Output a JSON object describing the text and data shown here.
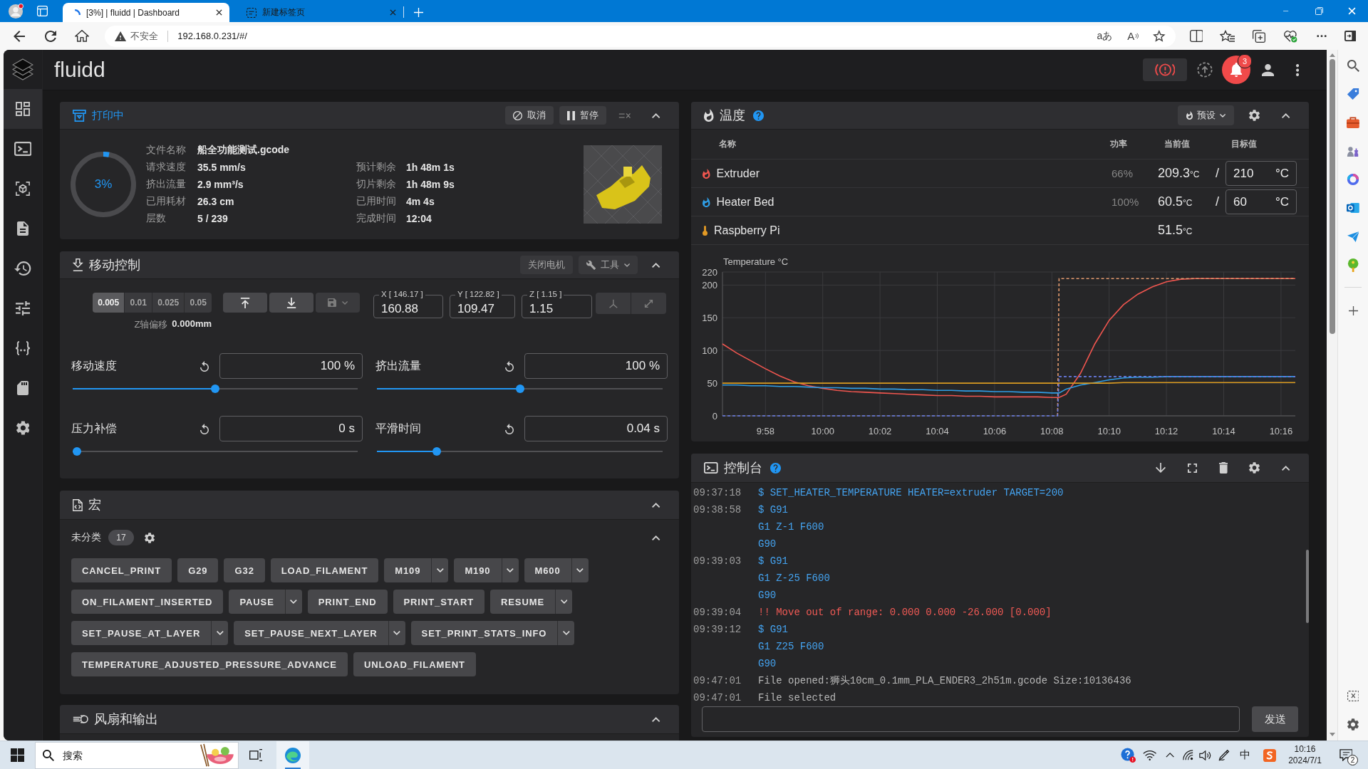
{
  "browser": {
    "tabs": [
      {
        "kind": "loading",
        "title": "[3%] | fluidd | Dashboard",
        "selected": true
      },
      {
        "kind": "newtab",
        "title": "新建标签页",
        "selected": false
      }
    ],
    "security_label": "不安全",
    "address": "192.168.0.231/#/",
    "translate_glyph": "aあ",
    "read_aloud_glyph": "A"
  },
  "app": {
    "brand": "fluidd",
    "nav": [
      {
        "kind": "dashboard",
        "selected": true
      },
      {
        "kind": "console",
        "selected": false
      },
      {
        "kind": "model",
        "selected": false
      },
      {
        "kind": "files",
        "selected": false
      },
      {
        "kind": "history",
        "selected": false
      },
      {
        "kind": "tune",
        "selected": false
      },
      {
        "kind": "macros",
        "selected": false
      },
      {
        "kind": "storage",
        "selected": false
      },
      {
        "kind": "settings",
        "selected": false
      }
    ],
    "notification_count": "3"
  },
  "print_status": {
    "title": "打印中",
    "actions": [
      {
        "kind": "cancel",
        "label": "取消"
      },
      {
        "kind": "pause",
        "label": "暂停"
      }
    ],
    "progress": {
      "label": "3%",
      "level": 0.03
    },
    "details": [
      {
        "label": "文件名称",
        "value": "船全功能测试.gcode"
      },
      {
        "label": "请求速度",
        "value": "35.5 mm/s"
      },
      {
        "label": "挤出流量",
        "value": "2.9 mm³/s"
      },
      {
        "label": "已用耗材",
        "value": "26.3 cm"
      },
      {
        "label": "层数",
        "value": "5 / 239"
      }
    ],
    "times": [
      {
        "label": "预计剩余",
        "value": "1h 48m 1s"
      },
      {
        "label": "切片剩余",
        "value": "1h 48m 9s"
      },
      {
        "label": "已用时间",
        "value": "4m 4s"
      },
      {
        "label": "完成时间",
        "value": "12:04"
      }
    ]
  },
  "motion": {
    "title": "移动控制",
    "actions": [
      {
        "kind": "motors_off",
        "label": "关闭电机"
      },
      {
        "kind": "tools",
        "label": "工具"
      }
    ],
    "steps": [
      {
        "label": "0.005",
        "selected": true
      },
      {
        "label": "0.01",
        "selected": false
      },
      {
        "label": "0.025",
        "selected": false
      },
      {
        "label": "0.05",
        "selected": false
      }
    ],
    "z_offset": {
      "label": "Z轴偏移",
      "value": "0.000mm"
    },
    "z_buttons": [
      {
        "kind": "up",
        "disabled": false
      },
      {
        "kind": "down",
        "disabled": false
      },
      {
        "kind": "save",
        "disabled": true
      }
    ],
    "positions": [
      {
        "legend": "X [ 146.17 ]",
        "value": "160.88"
      },
      {
        "legend": "Y [ 122.82 ]",
        "value": "109.47"
      },
      {
        "legend": "Z [ 1.15 ]",
        "value": "1.15"
      }
    ],
    "axis_buttons": [
      {
        "kind": "home",
        "disabled": true
      },
      {
        "kind": "expand",
        "disabled": true
      }
    ],
    "tuners": [
      {
        "label": "移动速度",
        "value": "100 %",
        "level": 0.5
      },
      {
        "label": "挤出流量",
        "value": "100 %",
        "level": 0.5
      },
      {
        "label": "压力补偿",
        "value": "0 s",
        "level": 0
      },
      {
        "label": "平滑时间",
        "value": "0.04 s",
        "level": 0.2
      }
    ]
  },
  "macros": {
    "title": "宏",
    "category": {
      "name": "未分类",
      "count": "17"
    },
    "items": [
      {
        "label": "CANCEL_PRINT",
        "has_menu": false
      },
      {
        "label": "G29",
        "has_menu": false
      },
      {
        "label": "G32",
        "has_menu": false
      },
      {
        "label": "LOAD_FILAMENT",
        "has_menu": false
      },
      {
        "label": "M109",
        "has_menu": true
      },
      {
        "label": "M190",
        "has_menu": true
      },
      {
        "label": "M600",
        "has_menu": true
      },
      {
        "label": "ON_FILAMENT_INSERTED",
        "has_menu": false
      },
      {
        "label": "PAUSE",
        "has_menu": true
      },
      {
        "label": "PRINT_END",
        "has_menu": false
      },
      {
        "label": "PRINT_START",
        "has_menu": false
      },
      {
        "label": "RESUME",
        "has_menu": true
      },
      {
        "label": "SET_PAUSE_AT_LAYER",
        "has_menu": true
      },
      {
        "label": "SET_PAUSE_NEXT_LAYER",
        "has_menu": true
      },
      {
        "label": "SET_PRINT_STATS_INFO",
        "has_menu": true
      },
      {
        "label": "TEMPERATURE_ADJUSTED_PRESSURE_ADVANCE",
        "has_menu": false
      },
      {
        "label": "UNLOAD_FILAMENT",
        "has_menu": false
      }
    ]
  },
  "fans": {
    "title": "风扇和输出"
  },
  "temperature": {
    "title": "温度",
    "preset_label": "预设",
    "columns": [
      "名称",
      "功率",
      "当前值",
      "目标值"
    ],
    "rows": [
      {
        "kind": "heater",
        "name": "Extruder",
        "color": "#f0564f",
        "power": "66%",
        "current": "209.3",
        "current_unit": "°C",
        "separator": "/",
        "target": "210",
        "target_unit": "°C"
      },
      {
        "kind": "heater",
        "name": "Heater Bed",
        "color": "#2f9ee6",
        "power": "100%",
        "current": "60.5",
        "current_unit": "°C",
        "separator": "/",
        "target": "60",
        "target_unit": "°C"
      },
      {
        "kind": "sensor",
        "name": "Raspberry Pi",
        "color": "#e39a25",
        "current": "51.5",
        "current_unit": "°C"
      }
    ],
    "chart_data": {
      "type": "line",
      "title": "Temperature °C",
      "grid": true,
      "x": [
        596.5,
        597,
        597.5,
        598,
        598.5,
        599,
        599.5,
        600,
        600.5,
        601,
        601.5,
        602,
        602.5,
        603,
        603.5,
        604,
        604.5,
        605,
        605.5,
        606,
        606.5,
        607,
        607.5,
        608,
        608.2,
        608.25,
        608.5,
        609,
        609.5,
        610,
        610.5,
        611,
        611.5,
        612,
        612.5,
        613,
        613.5,
        614,
        614.5,
        615,
        615.5,
        616,
        616.5
      ],
      "xlim": [
        596.5,
        616.5
      ],
      "ylim": [
        0,
        220
      ],
      "xticks": [
        {
          "value": 598,
          "label": "9:58"
        },
        {
          "value": 600,
          "label": "10:00"
        },
        {
          "value": 602,
          "label": "10:02"
        },
        {
          "value": 604,
          "label": "10:04"
        },
        {
          "value": 606,
          "label": "10:06"
        },
        {
          "value": 608,
          "label": "10:08"
        },
        {
          "value": 610,
          "label": "10:10"
        },
        {
          "value": 612,
          "label": "10:12"
        },
        {
          "value": 614,
          "label": "10:14"
        },
        {
          "value": 616,
          "label": "10:16"
        }
      ],
      "yticks": [
        0,
        50,
        100,
        150,
        200,
        220
      ],
      "series": [
        {
          "color": "#f0564f",
          "line_style": "solid",
          "values": [
            110,
            96,
            84,
            72,
            61,
            52,
            46,
            42,
            39,
            37,
            36,
            35,
            34,
            33,
            32,
            31,
            31,
            30,
            30,
            29,
            29,
            29,
            29,
            28,
            28,
            28,
            33,
            65,
            110,
            146,
            170,
            186,
            197,
            205,
            209,
            210,
            210,
            210,
            210,
            210,
            210,
            210,
            210
          ]
        },
        {
          "color": "#e39a6e",
          "line_style": "dashed",
          "values": [
            null,
            null,
            null,
            null,
            null,
            null,
            null,
            null,
            null,
            null,
            null,
            null,
            null,
            null,
            null,
            null,
            null,
            null,
            null,
            null,
            null,
            null,
            null,
            null,
            0,
            210,
            210,
            210,
            210,
            210,
            210,
            210,
            210,
            210,
            210,
            210,
            210,
            210,
            210,
            210,
            210,
            210,
            210
          ]
        },
        {
          "color": "#2f9ee6",
          "line_style": "solid",
          "values": [
            47,
            47,
            46,
            46,
            45,
            45,
            44,
            43,
            43,
            42,
            42,
            41,
            41,
            40,
            40,
            39,
            39,
            38,
            38,
            37,
            37,
            36,
            36,
            35,
            35,
            35,
            41,
            47,
            51,
            55,
            58,
            59,
            59,
            60,
            60,
            60,
            60,
            60,
            60,
            60,
            60,
            60,
            60
          ]
        },
        {
          "color": "#6a7ce6",
          "line_style": "dashed",
          "values": [
            0,
            0,
            0,
            0,
            0,
            0,
            0,
            0,
            0,
            0,
            0,
            0,
            0,
            0,
            0,
            0,
            0,
            0,
            0,
            0,
            0,
            0,
            0,
            0,
            0,
            60,
            60,
            60,
            60,
            60,
            60,
            60,
            60,
            60,
            60,
            60,
            60,
            60,
            60,
            60,
            60,
            60,
            60
          ]
        },
        {
          "color": "#d99a21",
          "line_style": "solid",
          "values": [
            50,
            50,
            50,
            50,
            50,
            50,
            50,
            50,
            50,
            50,
            50,
            50,
            50,
            50,
            50,
            50,
            50,
            50,
            50,
            50,
            50,
            50,
            50,
            50,
            50,
            50,
            50,
            50,
            50,
            50,
            51,
            51,
            51,
            51,
            51,
            51,
            51,
            51,
            51,
            51,
            51,
            51,
            51
          ]
        }
      ]
    }
  },
  "console": {
    "title": "控制台",
    "entries": [
      {
        "time": "09:37:18",
        "kind": "command",
        "lines": [
          "$ SET_HEATER_TEMPERATURE HEATER=extruder TARGET=200"
        ]
      },
      {
        "time": "09:38:58",
        "kind": "command",
        "lines": [
          "$ G91",
          "G1 Z-1 F600",
          "G90"
        ]
      },
      {
        "time": "09:39:03",
        "kind": "command",
        "lines": [
          "$ G91",
          "G1 Z-25 F600",
          "G90"
        ]
      },
      {
        "time": "09:39:04",
        "kind": "error",
        "lines": [
          "!! Move out of range: 0.000 0.000 -26.000 [0.000]"
        ]
      },
      {
        "time": "09:39:12",
        "kind": "command",
        "lines": [
          "$ G91",
          "G1 Z25 F600",
          "G90"
        ]
      },
      {
        "time": "09:47:01",
        "kind": "response",
        "lines": [
          "File opened:狮头10cm_0.1mm_PLA_ENDER3_2h51m.gcode Size:10136436"
        ]
      },
      {
        "time": "09:47:01",
        "kind": "response",
        "lines": [
          "File selected"
        ]
      }
    ],
    "send_label": "发送"
  },
  "taskbar": {
    "placeholder": "搜索",
    "pinned": [
      {
        "kind": "task_view",
        "selected": false
      },
      {
        "kind": "browser",
        "selected": true
      }
    ],
    "ime_label": "中",
    "time": "10:16",
    "date": "2024/7/1",
    "notification_count": "2"
  }
}
